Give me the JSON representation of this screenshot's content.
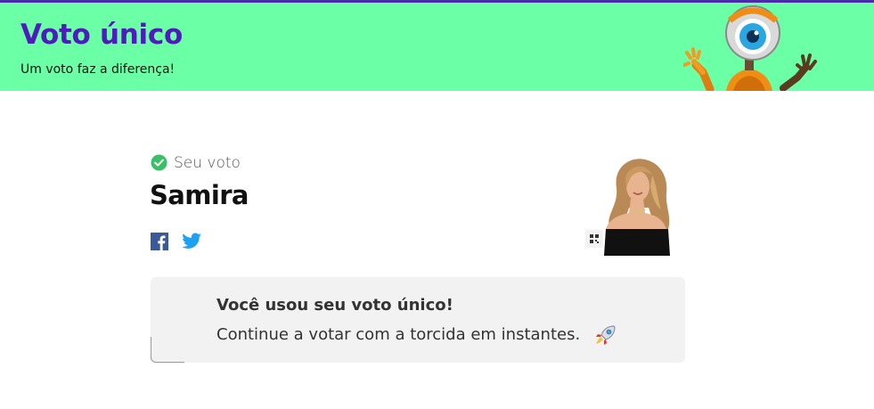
{
  "header": {
    "title": "Voto único",
    "subtitle": "Um voto faz a diferença!",
    "background_color": "#6bffa6",
    "title_color": "#4e1bbd"
  },
  "vote": {
    "status_label": "Seu voto",
    "candidate_name": "Samira",
    "check_color": "#3cbf68"
  },
  "share": {
    "facebook_icon": "facebook-icon",
    "twitter_icon": "twitter-icon"
  },
  "message": {
    "heading": "Você usou seu voto único!",
    "body": "Continue a votar com a torcida em instantes.",
    "emoji_icon": "rocket-icon"
  }
}
